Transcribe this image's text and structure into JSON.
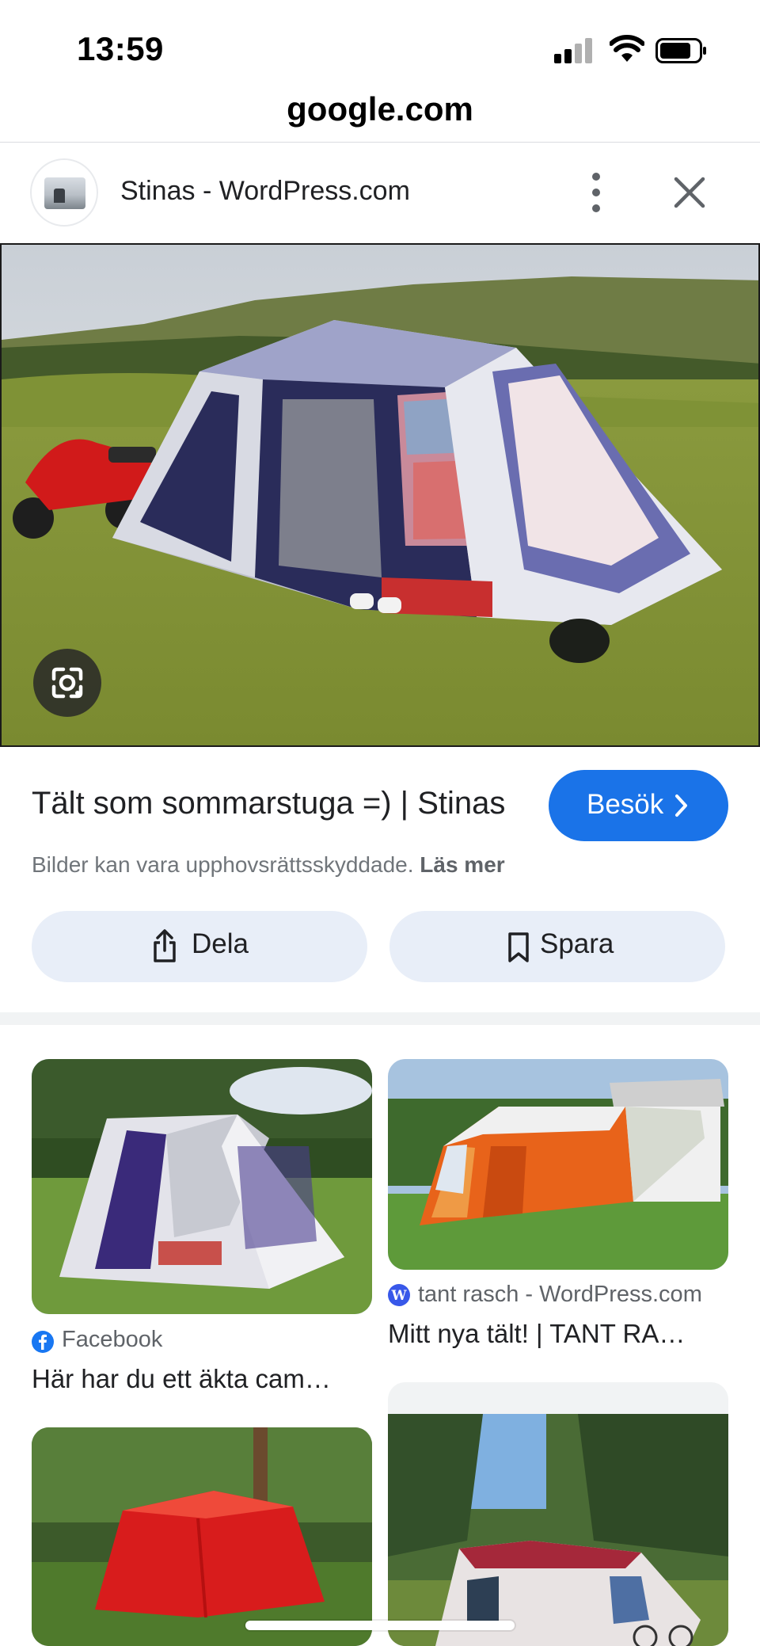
{
  "status_bar": {
    "time": "13:59",
    "icons": [
      "cellular-signal-icon",
      "wifi-icon",
      "battery-icon"
    ]
  },
  "browser": {
    "url": "google.com"
  },
  "source": {
    "title": "Stinas - WordPress.com",
    "icons": [
      "more-vertical-icon",
      "close-icon"
    ]
  },
  "result": {
    "title": "Tält som sommarstuga =) | Stinas",
    "visit_label": "Besök",
    "copyright_text": "Bilder kan vara upphovsrättsskyddade.",
    "read_more": "Läs mer",
    "share_label": "Dela",
    "save_label": "Spara"
  },
  "related": [
    {
      "source": "Facebook",
      "title": "Här har du ett äkta cam…",
      "icon": "facebook-icon"
    },
    {
      "source": "tant rasch - WordPress.com",
      "title": "Mitt nya tält! | TANT RA…",
      "icon": "wordpress-icon"
    }
  ],
  "colors": {
    "accent": "#1a73e8",
    "action_button_bg": "#e8eef8",
    "facebook": "#1877f2",
    "wordpress": "#3858e9"
  }
}
